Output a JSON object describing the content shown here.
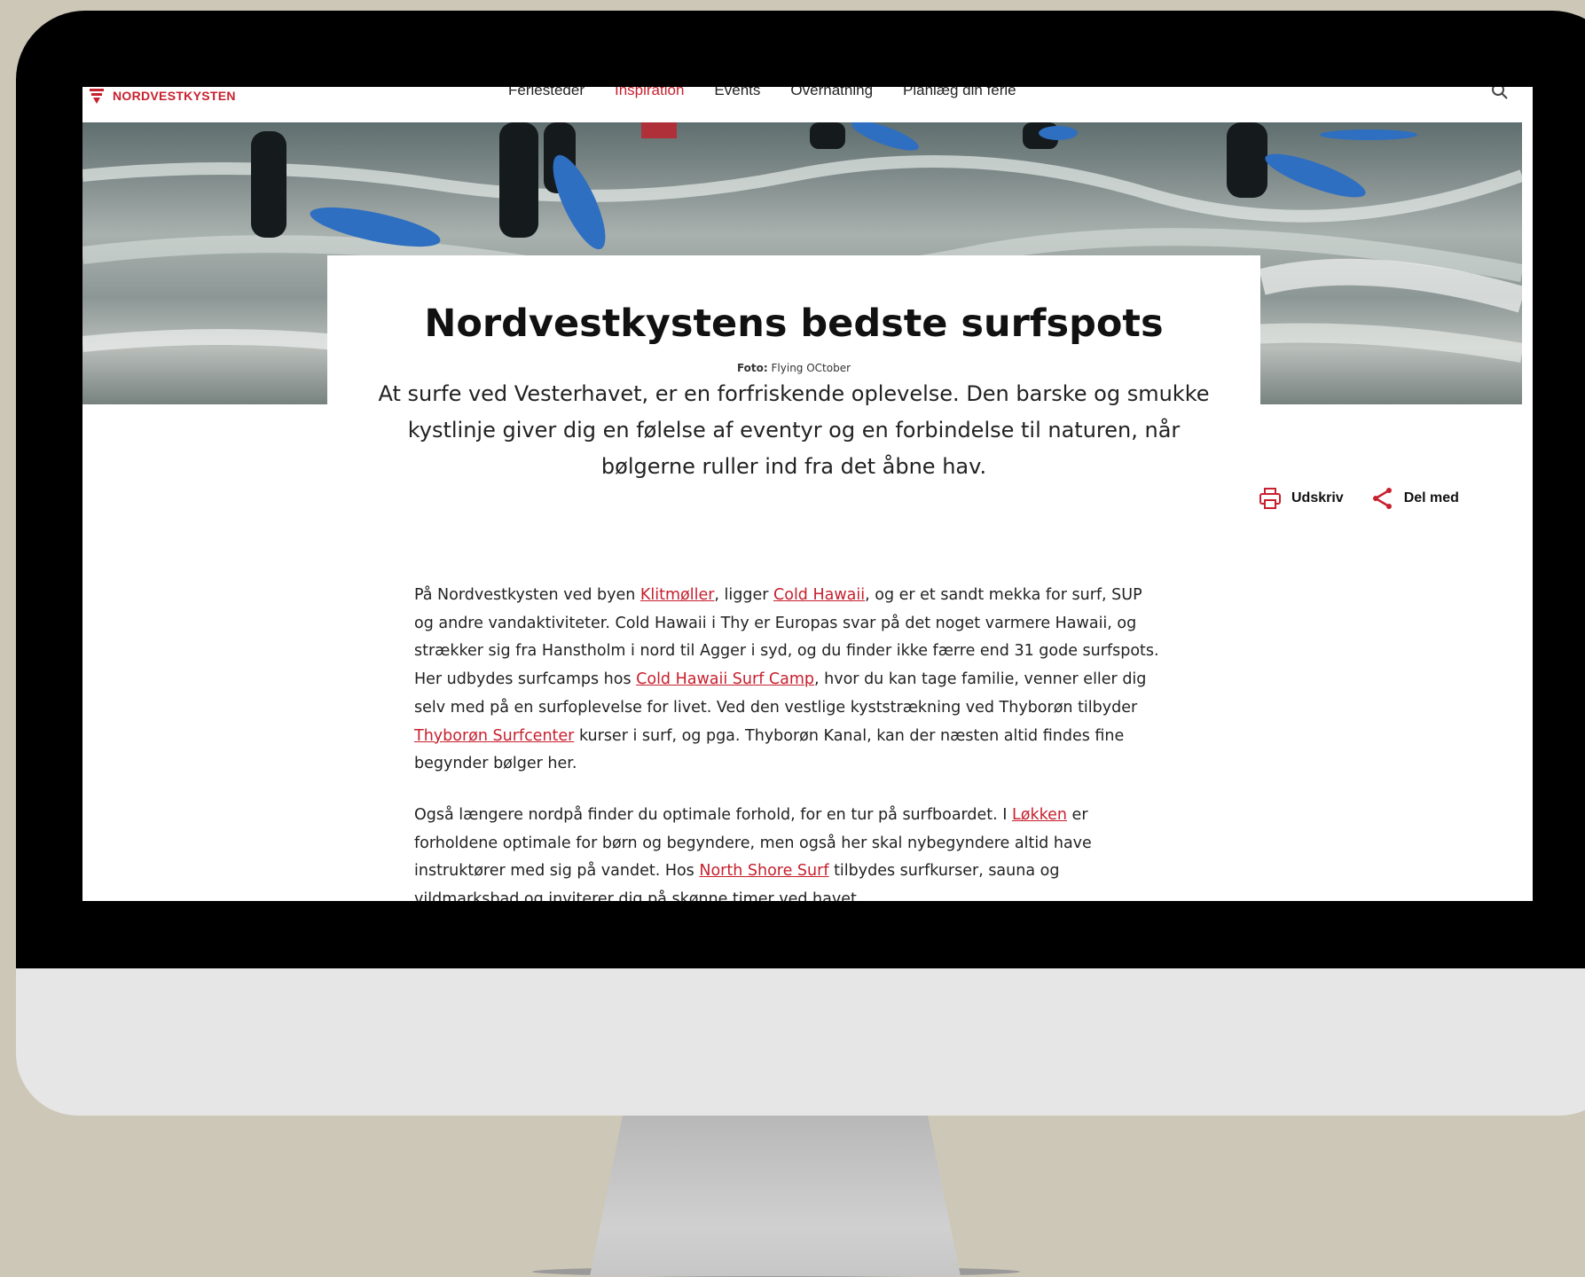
{
  "brand": {
    "logo_text": "NORDVESTKYSTEN",
    "accent_color": "#c7202e"
  },
  "nav": {
    "items": [
      {
        "label": "Feriesteder",
        "active": false
      },
      {
        "label": "Inspiration",
        "active": true
      },
      {
        "label": "Events",
        "active": false
      },
      {
        "label": "Overnatning",
        "active": false
      },
      {
        "label": "Planlæg din ferie",
        "active": false
      }
    ],
    "search_icon": "search-icon"
  },
  "article": {
    "title": "Nordvestkystens bedste surfspots",
    "photo_credit_label": "Foto:",
    "photo_credit_value": "Flying OCtober",
    "lead": "At surfe ved Vesterhavet, er en forfriskende oplevelse. Den barske og smukke kystlinje giver dig en følelse af eventyr og en forbindelse til naturen, når bølgerne ruller ind fra det åbne hav.",
    "actions": {
      "print_label": "Udskriv",
      "print_icon": "printer-icon",
      "share_label": "Del med",
      "share_icon": "share-icon"
    },
    "paragraphs": [
      {
        "segments": [
          {
            "text": "På Nordvestkysten ved byen "
          },
          {
            "text": "Klitmøller",
            "link": true
          },
          {
            "text": ", ligger "
          },
          {
            "text": "Cold Hawaii",
            "link": true
          },
          {
            "text": ", og er et sandt mekka for surf, SUP og andre vandaktiviteter. Cold Hawaii i Thy er Europas svar på det noget varmere Hawaii, og strækker sig fra Hanstholm i nord til Agger i syd, og du finder ikke færre end 31 gode surfspots. Her udbydes surfcamps hos "
          },
          {
            "text": "Cold Hawaii Surf Camp",
            "link": true
          },
          {
            "text": ", hvor du kan tage familie, venner eller dig selv med på en surfoplevelse for livet. Ved den vestlige kyststrækning ved Thyborøn tilbyder "
          },
          {
            "text": "Thyborøn Surfcenter",
            "link": true
          },
          {
            "text": " kurser i surf, og pga. Thyborøn Kanal, kan der næsten altid findes fine begynder bølger her."
          }
        ]
      },
      {
        "segments": [
          {
            "text": "Også længere nordpå finder du optimale forhold, for en tur på surfboardet. I "
          },
          {
            "text": "Løkken",
            "link": true
          },
          {
            "text": " er forholdene optimale for børn og begyndere, men også her skal nybegyndere altid have instruktører med sig på vandet. Hos "
          },
          {
            "text": "North Shore Surf",
            "link": true
          },
          {
            "text": " tilbydes surfkurser, sauna og vildmarksbad og inviterer dig på skønne timer ved havet."
          }
        ]
      }
    ]
  }
}
